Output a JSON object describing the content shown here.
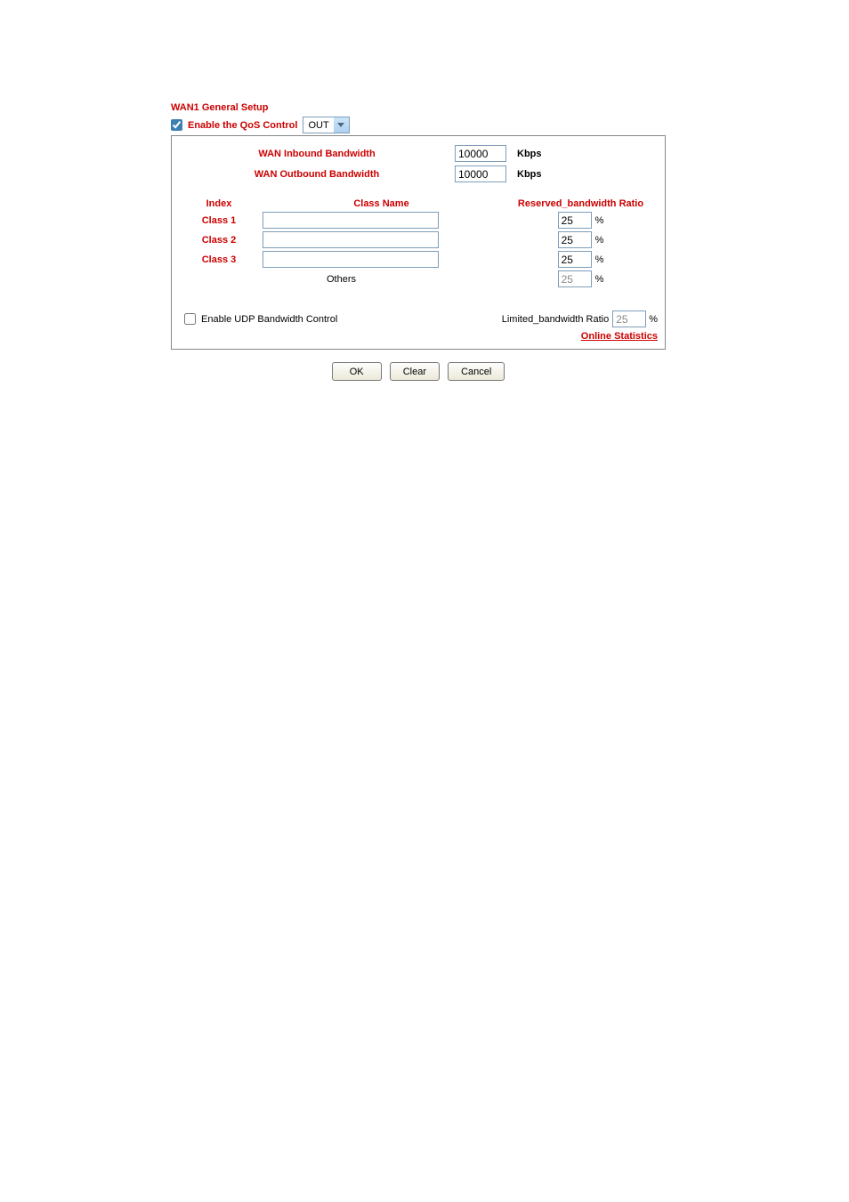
{
  "title": "WAN1 General Setup",
  "enable_qos": {
    "label": "Enable the QoS Control",
    "checked": true,
    "select_value": "OUT"
  },
  "bandwidth": {
    "inbound_label": "WAN Inbound Bandwidth",
    "inbound_value": "10000",
    "outbound_label": "WAN Outbound Bandwidth",
    "outbound_value": "10000",
    "unit": "Kbps"
  },
  "headers": {
    "index": "Index",
    "class_name": "Class Name",
    "ratio": "Reserved_bandwidth Ratio"
  },
  "classes": [
    {
      "index": "Class 1",
      "name": "",
      "ratio": "25"
    },
    {
      "index": "Class 2",
      "name": "",
      "ratio": "25"
    },
    {
      "index": "Class 3",
      "name": "",
      "ratio": "25"
    }
  ],
  "others": {
    "label": "Others",
    "ratio": "25"
  },
  "udp": {
    "checked": false,
    "label": "Enable UDP Bandwidth Control",
    "ratio_label": "Limited_bandwidth Ratio",
    "ratio_value": "25"
  },
  "online_stats": "Online Statistics",
  "buttons": {
    "ok": "OK",
    "clear": "Clear",
    "cancel": "Cancel"
  },
  "percent": "%"
}
